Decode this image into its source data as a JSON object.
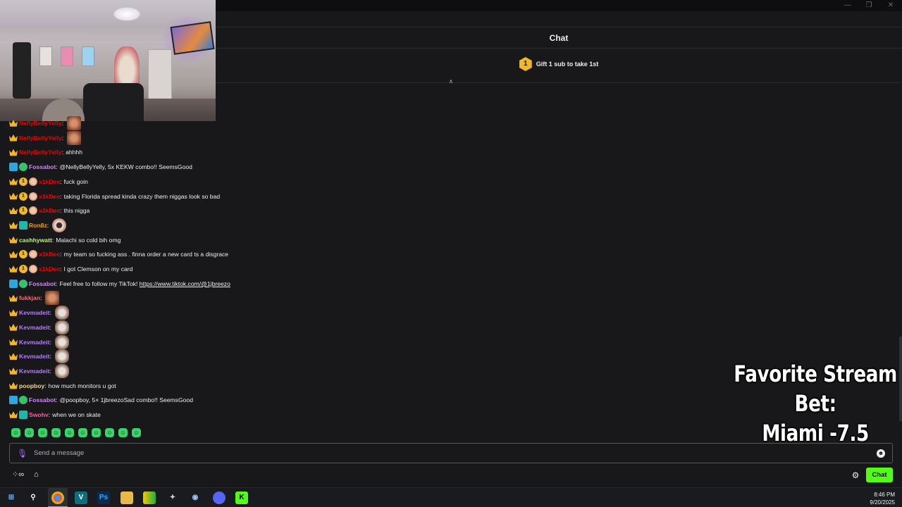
{
  "window": {
    "minimize_icon": "minimize-icon",
    "restore_icon": "restore-icon",
    "close_icon": "close-icon"
  },
  "header": {
    "title": "Chat"
  },
  "gift": {
    "badge_number": "1",
    "text": "Gift 1 sub to take 1st"
  },
  "messages": [
    {
      "user": "NellyBellyYelly",
      "user_color": "#eb0400",
      "badges": [
        "crown"
      ],
      "text": "",
      "emote": "face"
    },
    {
      "user": "NellyBellyYelly",
      "user_color": "#eb0400",
      "badges": [
        "crown"
      ],
      "text": "",
      "emote": "face"
    },
    {
      "user": "NellyBellyYelly",
      "user_color": "#eb0400",
      "badges": [
        "crown"
      ],
      "text": "ahhhh",
      "emote": ""
    },
    {
      "user": "Fossabot",
      "user_color": "#d783ff",
      "badges": [
        "bot",
        "verified"
      ],
      "text": "@NellyBellyYelly, 5x KEKW combo!! SeemsGood",
      "emote": ""
    },
    {
      "user": "x1kDee",
      "user_color": "#eb0400",
      "badges": [
        "crown",
        "coin",
        "face"
      ],
      "text": "fuck goin",
      "emote": ""
    },
    {
      "user": "x1kDee",
      "user_color": "#eb0400",
      "badges": [
        "crown",
        "coin",
        "face"
      ],
      "text": "taking Florida spread kinda crazy them niggas look so bad",
      "emote": ""
    },
    {
      "user": "x1kDee",
      "user_color": "#eb0400",
      "badges": [
        "crown",
        "coin",
        "face"
      ],
      "text": "this nigga",
      "emote": ""
    },
    {
      "user": "Ron8z",
      "user_color": "#ff9d00",
      "badges": [
        "crown",
        "prime"
      ],
      "text": "",
      "emote": "hair"
    },
    {
      "user": "cashhywatt",
      "user_color": "#b7f57c",
      "badges": [
        "crown"
      ],
      "text": "Malachi so cold bih omg",
      "emote": ""
    },
    {
      "user": "x1kDee",
      "user_color": "#eb0400",
      "badges": [
        "crown",
        "coin",
        "face"
      ],
      "text": "my team so fucking ass . finna order a new card ts a disgrace",
      "emote": ""
    },
    {
      "user": "x1kDee",
      "user_color": "#eb0400",
      "badges": [
        "crown",
        "coin",
        "face"
      ],
      "text": "I got Clemson on my card",
      "emote": ""
    },
    {
      "user": "Fossabot",
      "user_color": "#d783ff",
      "badges": [
        "bot",
        "verified"
      ],
      "text": "Feel free to follow my TikTok! ",
      "link": "https://www.tiktok.com/@1jbreezo",
      "emote": ""
    },
    {
      "user": "fukkjan",
      "user_color": "#ff6a6a",
      "badges": [
        "crown"
      ],
      "text": "",
      "emote": "face"
    },
    {
      "user": "Kevmadeit",
      "user_color": "#b67bff",
      "badges": [
        "crown"
      ],
      "text": "",
      "emote": "dog"
    },
    {
      "user": "Kevmadeit",
      "user_color": "#b67bff",
      "badges": [
        "crown"
      ],
      "text": "",
      "emote": "dog"
    },
    {
      "user": "Kevmadeit",
      "user_color": "#b67bff",
      "badges": [
        "crown"
      ],
      "text": "",
      "emote": "dog"
    },
    {
      "user": "Kevmadeit",
      "user_color": "#b67bff",
      "badges": [
        "crown"
      ],
      "text": "",
      "emote": "dog"
    },
    {
      "user": "Kevmadeit",
      "user_color": "#b67bff",
      "badges": [
        "crown"
      ],
      "text": "",
      "emote": "dog"
    },
    {
      "user": "poopboy",
      "user_color": "#f5d78a",
      "badges": [
        "crown"
      ],
      "text": "how much monitors u got",
      "emote": ""
    },
    {
      "user": "Fossabot",
      "user_color": "#d783ff",
      "badges": [
        "bot",
        "verified"
      ],
      "text": "@poopboy, 5× 1jbreezoSad combo!! SeemsGood",
      "emote": ""
    },
    {
      "user": "Swohv",
      "user_color": "#ff5da2",
      "badges": [
        "crown",
        "prime"
      ],
      "text": "when we on skate",
      "emote": ""
    }
  ],
  "emote_bar": [
    "green-emote-icon",
    "green-emote-icon",
    "green-emote-icon",
    "green-emote-icon",
    "green-emote-icon",
    "green-emote-icon",
    "green-emote-icon",
    "green-emote-icon",
    "green-emote-icon",
    "green-emote-icon"
  ],
  "input": {
    "placeholder": "Send a message"
  },
  "footer": {
    "chat_button": "Chat"
  },
  "overlay": {
    "line1": "Favorite Stream Bet:",
    "line2": "Miami -7.5"
  },
  "taskbar": {
    "time": "8:46 PM",
    "date": "9/20/2025"
  },
  "colors": {
    "accent": "#53fc18",
    "background": "#18181b"
  }
}
